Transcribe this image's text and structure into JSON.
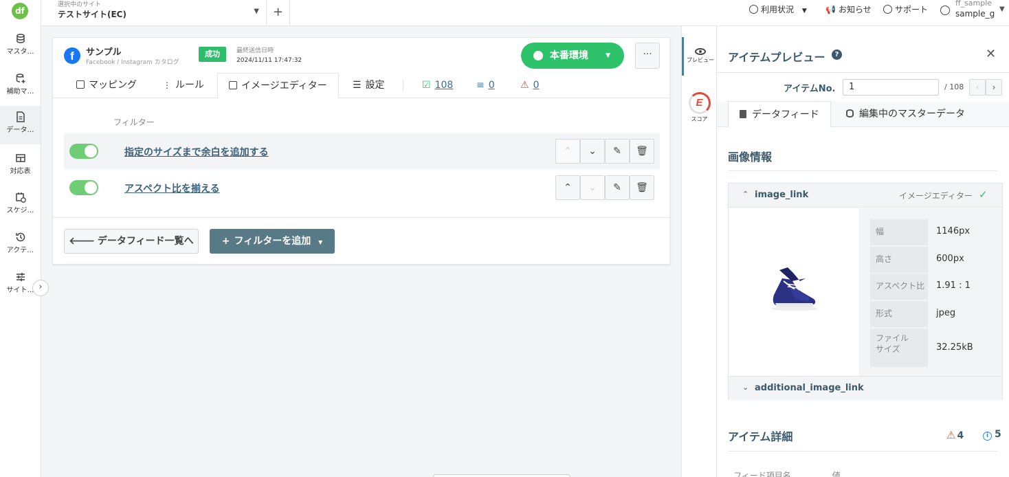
{
  "sidebar": {
    "logo": "df",
    "items": [
      {
        "label": "マスタ…",
        "icon": "database-icon"
      },
      {
        "label": "補助マ…",
        "icon": "database-plus-icon"
      },
      {
        "label": "データ…",
        "icon": "document-icon"
      },
      {
        "label": "対応表",
        "icon": "table-icon"
      },
      {
        "label": "スケジ…",
        "icon": "calendar-clock-icon"
      },
      {
        "label": "アクテ…",
        "icon": "history-icon"
      },
      {
        "label": "サイト…",
        "icon": "sliders-icon"
      }
    ],
    "active_index": 2
  },
  "topbar": {
    "site_caption": "選択中のサイト",
    "site_name": "テストサイト(EC)",
    "usage": "利用状況",
    "notice": "お知らせ",
    "support": "サポート",
    "user_line1": "ff_sample",
    "user_line2": "sample_g"
  },
  "feed": {
    "name": "サンプル",
    "subtitle": "Facebook / Instagram カタログ",
    "status": "成功",
    "last_sent_label": "最終送信日時",
    "last_sent_value": "2024/11/11 17:47:32",
    "env_label": "本番環境",
    "more_label": "···"
  },
  "tabs": [
    {
      "label": "マッピング"
    },
    {
      "label": "ルール"
    },
    {
      "label": "イメージエディター"
    },
    {
      "label": "設定"
    }
  ],
  "stats": {
    "ok": "108",
    "excluded": "0",
    "warnings": "0"
  },
  "filters": {
    "heading": "フィルター",
    "items": [
      {
        "name": "指定のサイズまで余白を追加する",
        "enabled": true
      },
      {
        "name": "アスペクト比を揃える",
        "enabled": true
      }
    ]
  },
  "actions": {
    "back": "データフィード一覧へ",
    "add_filter": "フィルターを追加"
  },
  "preview_toolbar": {
    "preview": "プレビュー",
    "score": "スコア",
    "score_letter": "E"
  },
  "preview": {
    "title": "アイテムプレビュー",
    "item_no_label": "アイテムNo.",
    "item_no_value": "1",
    "item_total": "/ 108",
    "tabs": [
      "データフィード",
      "編集中のマスターデータ"
    ],
    "image_section": "画像情報",
    "image_link_label": "image_link",
    "image_editor_label": "イメージエディター",
    "image_meta": [
      {
        "label": "幅",
        "value": "1146px"
      },
      {
        "label": "高さ",
        "value": "600px"
      },
      {
        "label": "アスペクト比",
        "value": "1.91 : 1"
      },
      {
        "label": "形式",
        "value": "jpeg"
      },
      {
        "label": "ファイル\nサイズ",
        "value": "32.25kB"
      }
    ],
    "additional_image_link_label": "additional_image_link",
    "item_detail_title": "アイテム詳細",
    "warning_count": "4",
    "info_count": "5",
    "col_field": "フィード項目名",
    "col_value": "値"
  },
  "colors": {
    "accent_green": "#2ec36a",
    "brand_teal": "#587a86",
    "title": "#3c5a6b",
    "facebook": "#1877f2"
  }
}
